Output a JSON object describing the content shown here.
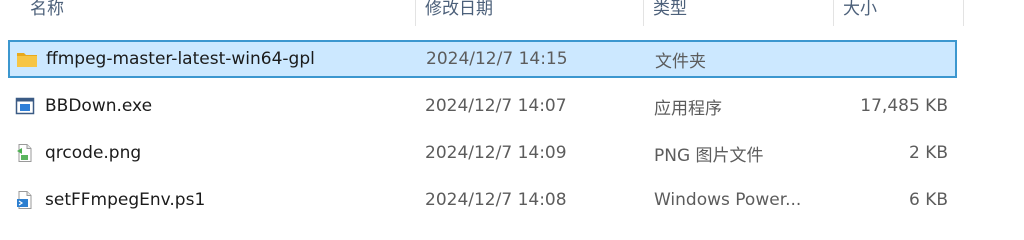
{
  "columns": {
    "name": "名称",
    "date": "修改日期",
    "type": "类型",
    "size": "大小"
  },
  "files": [
    {
      "name": "ffmpeg-master-latest-win64-gpl",
      "date": "2024/12/7 14:15",
      "type": "文件夹",
      "size": "",
      "icon": "folder-icon",
      "selected": true
    },
    {
      "name": "BBDown.exe",
      "date": "2024/12/7 14:07",
      "type": "应用程序",
      "size": "17,485 KB",
      "icon": "exe-icon",
      "selected": false
    },
    {
      "name": "qrcode.png",
      "date": "2024/12/7 14:09",
      "type": "PNG 图片文件",
      "size": "2 KB",
      "icon": "png-file-icon",
      "selected": false
    },
    {
      "name": "setFFmpegEnv.ps1",
      "date": "2024/12/7 14:08",
      "type": "Windows Power...",
      "size": "6 KB",
      "icon": "powershell-file-icon",
      "selected": false
    }
  ],
  "colors": {
    "selection_bg": "#cce8ff",
    "selection_border": "#3c97cf",
    "folder": "#f7c544"
  }
}
